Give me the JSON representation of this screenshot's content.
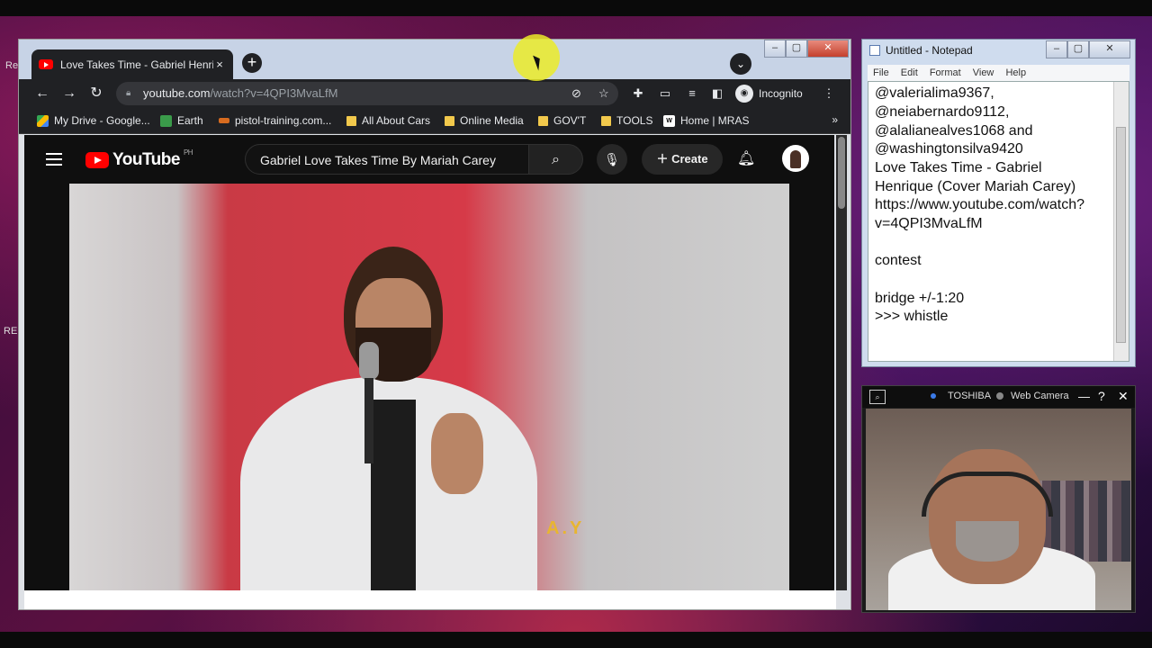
{
  "chrome": {
    "tab_title": "Love Takes Time - Gabriel Henriq",
    "tab_close": "×",
    "new_tab": "+",
    "address_host": "youtube.com",
    "address_path": "/watch?v=4QPI3MvaLfM",
    "incognito_label": "Incognito",
    "bookmarks": [
      {
        "label": "My Drive - Google...",
        "icon": "google-drive-icon"
      },
      {
        "label": "Earth",
        "icon": "google-earth-icon"
      },
      {
        "label": "pistol-training.com...",
        "icon": "site-icon"
      },
      {
        "label": "All About Cars",
        "icon": "folder-icon"
      },
      {
        "label": "Online Media",
        "icon": "folder-icon"
      },
      {
        "label": "GOV'T",
        "icon": "folder-icon"
      },
      {
        "label": "TOOLS",
        "icon": "folder-icon"
      },
      {
        "label": "Home | MRAS",
        "icon": "wix-icon"
      }
    ],
    "bookmarks_more": "»"
  },
  "youtube": {
    "logo_text": "YouTube",
    "country_code": "PH",
    "search_value": "Gabriel Love Takes Time By Mariah Carey",
    "create_label": "Create",
    "video_overlay_text": "A.Y"
  },
  "notepad": {
    "title": "Untitled - Notepad",
    "menu": [
      "File",
      "Edit",
      "Format",
      "View",
      "Help"
    ],
    "lines": [
      "@valerialima9367,",
      "@neiabernardo9112,",
      "@alalianealves1068 and",
      "@washingtonsilva9420",
      "Love Takes Time - Gabriel",
      "Henrique (Cover Mariah Carey)",
      "https://www.youtube.com/watch?",
      "v=4QPI3MvaLfM",
      "",
      "contest",
      "",
      "bridge +/-1:20",
      ">>> whistle"
    ]
  },
  "webcam": {
    "brand": "TOSHIBA",
    "title": "Web Camera",
    "help": "?",
    "close": "✕",
    "minimize": "—"
  },
  "desktop": {
    "left_text_1": "Re",
    "left_text_2": "RE"
  }
}
